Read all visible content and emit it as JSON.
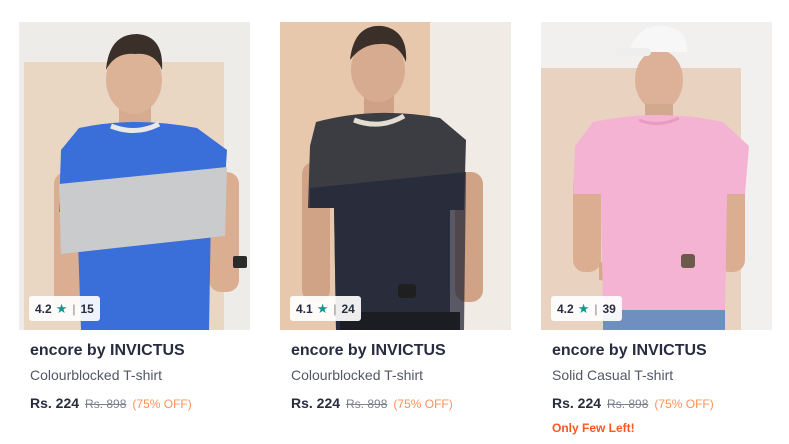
{
  "products": [
    {
      "brand": "encore by INVICTUS",
      "name": "Colourblocked T-shirt",
      "rating": "4.2",
      "rating_count": "15",
      "price": "Rs. 224",
      "mrp": "Rs. 898",
      "discount": "(75% OFF)",
      "stock_note": ""
    },
    {
      "brand": "encore by INVICTUS",
      "name": "Colourblocked T-shirt",
      "rating": "4.1",
      "rating_count": "24",
      "price": "Rs. 224",
      "mrp": "Rs. 898",
      "discount": "(75% OFF)",
      "stock_note": ""
    },
    {
      "brand": "encore by INVICTUS",
      "name": "Solid Casual T-shirt",
      "rating": "4.2",
      "rating_count": "39",
      "price": "Rs. 224",
      "mrp": "Rs. 898",
      "discount": "(75% OFF)",
      "stock_note": "Only Few Left!"
    }
  ],
  "icons": {
    "rating": "star-icon",
    "separator": "|"
  },
  "colors": {
    "star": "#14958f",
    "discount": "#ff905a",
    "stock_note": "#ff5722"
  }
}
